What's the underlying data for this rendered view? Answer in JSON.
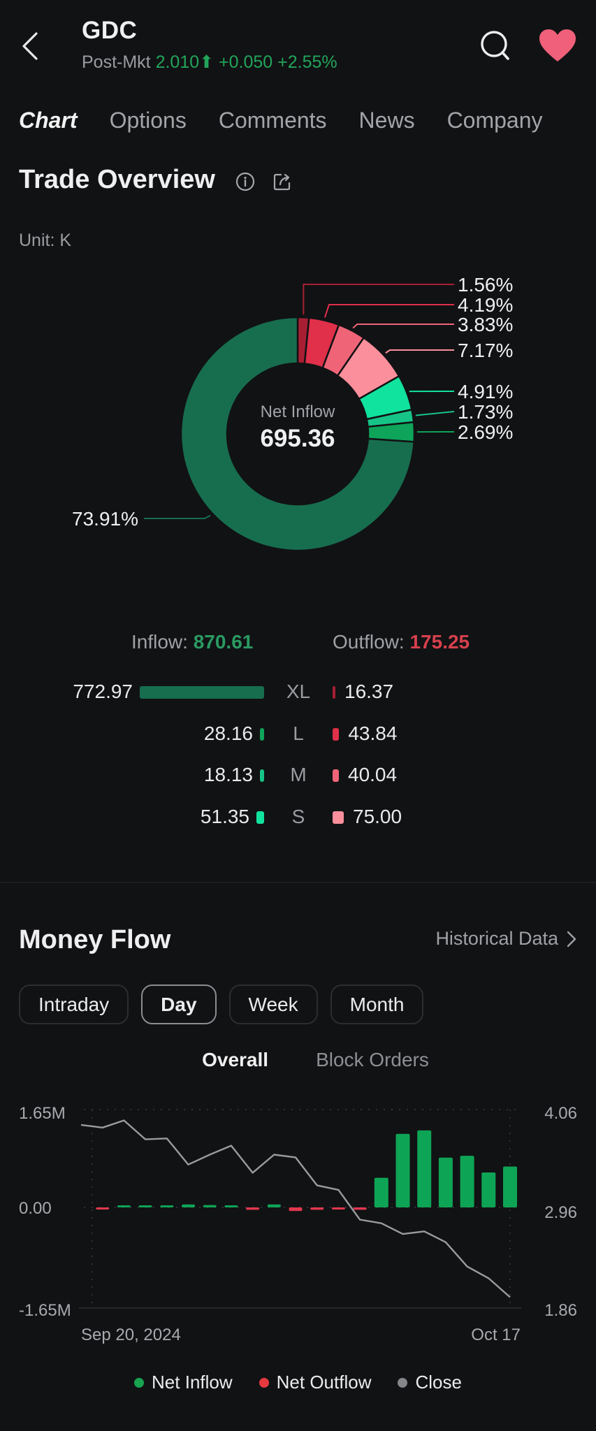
{
  "header": {
    "ticker": "GDC",
    "session_label": "Post-Mkt",
    "price": "2.010",
    "change": "+0.050",
    "change_pct": "+2.55%",
    "icons": {
      "back": "chevron-left-icon",
      "search": "search-icon",
      "watchlist": "heart-icon"
    }
  },
  "tabs": [
    {
      "label": "Chart",
      "active": true
    },
    {
      "label": "Options",
      "active": false
    },
    {
      "label": "Comments",
      "active": false
    },
    {
      "label": "News",
      "active": false
    },
    {
      "label": "Company",
      "active": false
    }
  ],
  "trade_overview": {
    "title": "Trade Overview",
    "unit": "Unit: K",
    "center_label": "Net Inflow",
    "center_value": "695.36",
    "inflow_label": "Inflow:",
    "inflow_value": "870.61",
    "outflow_label": "Outflow:",
    "outflow_value": "175.25",
    "rows": [
      {
        "size": "XL",
        "inflow": "772.97",
        "outflow": "16.37",
        "inflow_num": 772.97,
        "outflow_num": 16.37
      },
      {
        "size": "L",
        "inflow": "28.16",
        "outflow": "43.84",
        "inflow_num": 28.16,
        "outflow_num": 43.84
      },
      {
        "size": "M",
        "inflow": "18.13",
        "outflow": "40.04",
        "inflow_num": 18.13,
        "outflow_num": 40.04
      },
      {
        "size": "S",
        "inflow": "51.35",
        "outflow": "75.00",
        "inflow_num": 51.35,
        "outflow_num": 75.0
      }
    ]
  },
  "money_flow": {
    "title": "Money Flow",
    "historical_link": "Historical Data",
    "periods": [
      {
        "label": "Intraday",
        "active": false
      },
      {
        "label": "Day",
        "active": true
      },
      {
        "label": "Week",
        "active": false
      },
      {
        "label": "Month",
        "active": false
      }
    ],
    "subtabs": [
      {
        "label": "Overall",
        "active": true
      },
      {
        "label": "Block Orders",
        "active": false
      }
    ]
  },
  "colors": {
    "inflow_xl": "#176e4f",
    "inflow_l": "#0ea45a",
    "inflow_m": "#17c487",
    "inflow_s": "#10e39d",
    "outflow_xl": "#a81f33",
    "outflow_l": "#e0304a",
    "outflow_m": "#f06477",
    "outflow_s": "#fb8f9c",
    "net_inflow": "#0ea455",
    "net_outflow": "#e2374f",
    "close_line": "#9a9b9e",
    "accent": "#e0651b",
    "up": "#22a55a"
  },
  "chart_data": [
    {
      "type": "pie",
      "title": "Trade Overview",
      "center_label": "Net Inflow",
      "center_value": 695.36,
      "slices": [
        {
          "name": "Outflow XL",
          "percent": 1.56,
          "label": "1.56%",
          "color_key": "outflow_xl"
        },
        {
          "name": "Outflow L",
          "percent": 4.19,
          "label": "4.19%",
          "color_key": "outflow_l"
        },
        {
          "name": "Outflow M",
          "percent": 3.83,
          "label": "3.83%",
          "color_key": "outflow_m"
        },
        {
          "name": "Outflow S",
          "percent": 7.17,
          "label": "7.17%",
          "color_key": "outflow_s"
        },
        {
          "name": "Inflow S",
          "percent": 4.91,
          "label": "4.91%",
          "color_key": "inflow_s"
        },
        {
          "name": "Inflow M",
          "percent": 1.73,
          "label": "1.73%",
          "color_key": "inflow_m"
        },
        {
          "name": "Inflow L",
          "percent": 2.69,
          "label": "2.69%",
          "color_key": "inflow_l"
        },
        {
          "name": "Inflow XL",
          "percent": 73.91,
          "label": "73.91%",
          "color_key": "inflow_xl"
        }
      ]
    },
    {
      "type": "bar",
      "title": "Money Flow",
      "x_start_label": "Sep 20, 2024",
      "x_end_label": "Oct 17",
      "y_left_ticks": [
        "1.65M",
        "0.00",
        "-1.65M"
      ],
      "y_left_range": [
        -1.65,
        1.65
      ],
      "y_left_unit": "M",
      "y_right_ticks": [
        "4.06",
        "2.96",
        "1.86"
      ],
      "y_right_range": [
        1.86,
        4.06
      ],
      "legend": [
        "Net Inflow",
        "Net Outflow",
        "Close"
      ],
      "legend_position": "bottom",
      "series": [
        {
          "name": "Net Flow",
          "type": "bar",
          "values": [
            -0.02,
            0.02,
            0.02,
            0.02,
            0.05,
            0.04,
            0.02,
            -0.04,
            0.05,
            -0.06,
            -0.04,
            -0.02,
            -0.04,
            0.5,
            1.24,
            1.3,
            0.84,
            0.87,
            0.59,
            0.69
          ]
        },
        {
          "name": "Close",
          "type": "line",
          "values": [
            3.89,
            3.86,
            3.94,
            3.73,
            3.74,
            3.45,
            3.56,
            3.66,
            3.36,
            3.56,
            3.53,
            3.22,
            3.17,
            2.84,
            2.8,
            2.68,
            2.71,
            2.59,
            2.32,
            2.19,
            1.98
          ]
        }
      ]
    }
  ]
}
